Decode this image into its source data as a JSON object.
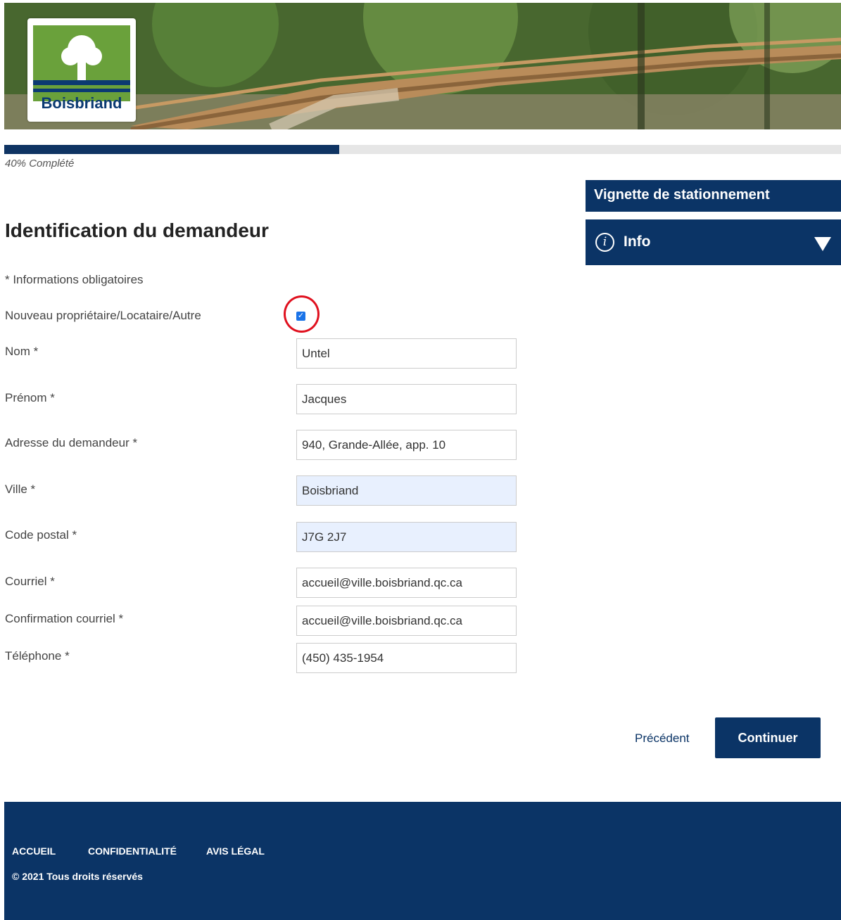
{
  "brand": {
    "logo_text": "Boisbriand"
  },
  "progress": {
    "percent": 40,
    "label": "40% Complété"
  },
  "side_panel": {
    "title": "Vignette de stationnement",
    "info_label": "Info"
  },
  "form": {
    "title": "Identification du demandeur",
    "required_note": "* Informations obligatoires",
    "checkbox_label": "Nouveau propriétaire/Locataire/Autre",
    "checkbox_checked": true,
    "fields": [
      {
        "label": "Nom *",
        "value": "Untel"
      },
      {
        "label": "Prénom *",
        "value": "Jacques"
      },
      {
        "label": "Adresse du demandeur *",
        "value": "940, Grande-Allée, app. 10"
      },
      {
        "label": "Ville *",
        "value": "Boisbriand"
      },
      {
        "label": "Code postal *",
        "value": "J7G 2J7"
      },
      {
        "label": "Courriel *",
        "value": "accueil@ville.boisbriand.qc.ca"
      },
      {
        "label": "Confirmation courriel *",
        "value": "accueil@ville.boisbriand.qc.ca"
      },
      {
        "label": "Téléphone *",
        "value": "(450) 435-1954"
      }
    ]
  },
  "actions": {
    "previous": "Précédent",
    "continue": "Continuer"
  },
  "footer": {
    "links": [
      "ACCUEIL",
      "CONFIDENTIALITÉ",
      "AVIS LÉGAL"
    ],
    "copyright": "© 2021 Tous droits réservés"
  },
  "colors": {
    "brand_blue": "#0b3466",
    "logo_green": "#6aa13b",
    "highlight_red": "#e0111f"
  }
}
